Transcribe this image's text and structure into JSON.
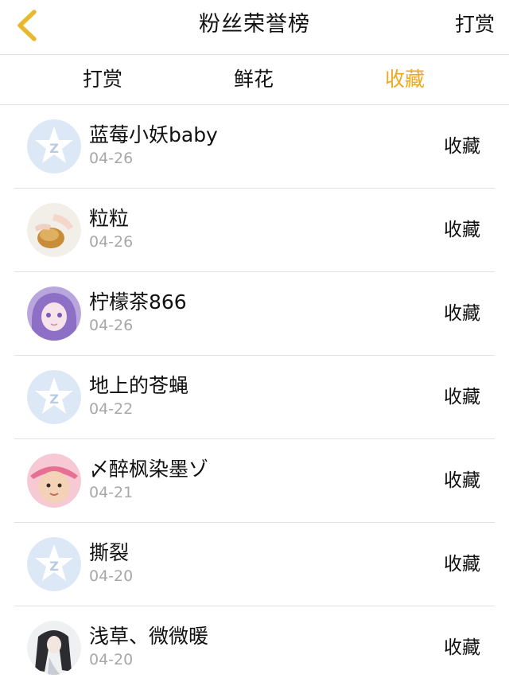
{
  "header": {
    "title": "粉丝荣誉榜",
    "right_action": "打赏"
  },
  "tabs": [
    {
      "label": "打赏",
      "active": false
    },
    {
      "label": "鲜花",
      "active": false
    },
    {
      "label": "收藏",
      "active": true
    }
  ],
  "colors": {
    "accent": "#f0a81c",
    "back_arrow": "#e8b92e",
    "default_avatar_bg": "#dce8f6",
    "default_avatar_fg": "#ffffff"
  },
  "rows": [
    {
      "name": "蓝莓小妖baby",
      "date": "04-26",
      "action": "收藏",
      "avatar": "default-qq-avatar"
    },
    {
      "name": "粒粒",
      "date": "04-26",
      "action": "收藏",
      "avatar": "photo-avatar-bread"
    },
    {
      "name": "柠檬茶866",
      "date": "04-26",
      "action": "收藏",
      "avatar": "photo-avatar-anime-girl"
    },
    {
      "name": "地上的苍蝇",
      "date": "04-22",
      "action": "收藏",
      "avatar": "default-qq-avatar"
    },
    {
      "name": "〆醉枫染墨ゾ",
      "date": "04-21",
      "action": "收藏",
      "avatar": "photo-avatar-baby"
    },
    {
      "name": "撕裂",
      "date": "04-20",
      "action": "收藏",
      "avatar": "default-qq-avatar"
    },
    {
      "name": "浅草、微微暖",
      "date": "04-20",
      "action": "收藏",
      "avatar": "photo-avatar-ink-girl"
    }
  ]
}
